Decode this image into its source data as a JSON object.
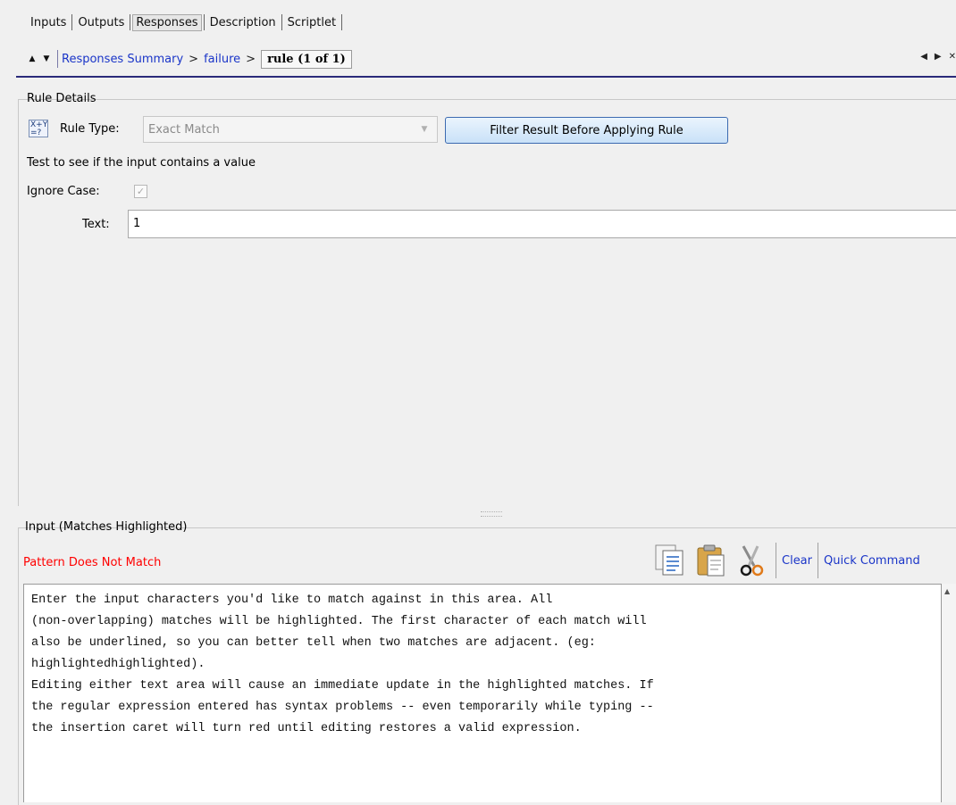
{
  "tabs": [
    {
      "label": "Inputs"
    },
    {
      "label": "Outputs"
    },
    {
      "label": "Responses"
    },
    {
      "label": "Description"
    },
    {
      "label": "Scriptlet"
    }
  ],
  "active_tab": "Responses",
  "breadcrumb": {
    "items": [
      "Responses Summary",
      "failure"
    ],
    "separator": ">",
    "current": "rule (1 of 1)"
  },
  "rule_details": {
    "section_title": "Rule Details",
    "rule_type_label": "Rule Type:",
    "rule_type_value": "Exact Match",
    "rule_icon_text": "X+Y =?",
    "filter_button_label": "Filter Result Before Applying Rule",
    "description": "Test to see if the input contains a value",
    "ignore_case_label": "Ignore Case:",
    "ignore_case_checked": true,
    "text_label": "Text:",
    "text_value": "1"
  },
  "input_section": {
    "title": "Input (Matches Highlighted)",
    "status": "Pattern Does Not Match",
    "status_color": "#ff0000",
    "clear_label": "Clear",
    "quick_command_label": "Quick Command",
    "toolbar_icons": [
      "copy-icon",
      "paste-icon",
      "cut-icon"
    ],
    "text_lines": [
      "Enter the input characters you'd like to match against in this area. All",
      "(non-overlapping) matches will be highlighted. The first character of each match will",
      "also be underlined, so you can better tell when two matches are adjacent. (eg:",
      "highlightedhighlighted).",
      "",
      "Editing either text area will cause an immediate update in the highlighted matches. If",
      "the regular expression entered has syntax problems -- even temporarily while typing --",
      "the insertion caret will turn red until editing restores a valid expression."
    ]
  },
  "colors": {
    "link": "#1a35c8",
    "nav_line": "#2a2a7a",
    "background": "#f0f0f0"
  }
}
